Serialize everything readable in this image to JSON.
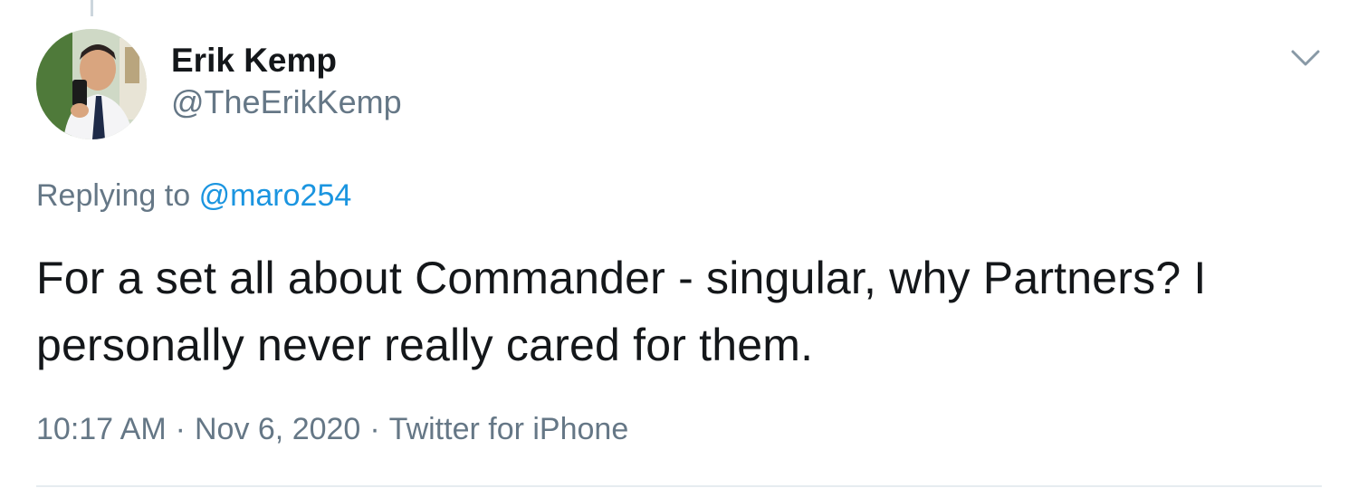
{
  "author": {
    "display_name": "Erik Kemp",
    "handle": "@TheErikKemp"
  },
  "reply": {
    "prefix": "Replying to",
    "mention": "@maro254"
  },
  "tweet": {
    "text": "For a set all about Commander - singular, why Partners? I personally never really cared for them."
  },
  "meta": {
    "time": "10:17 AM",
    "separator": "·",
    "date": "Nov 6, 2020",
    "source": "Twitter for iPhone"
  },
  "icons": {
    "menu": "chevron-down-icon",
    "avatar": "profile-photo"
  },
  "colors": {
    "text": "#14171a",
    "secondary": "#657786",
    "link": "#1b95e0",
    "divider": "#e6ecf0"
  }
}
